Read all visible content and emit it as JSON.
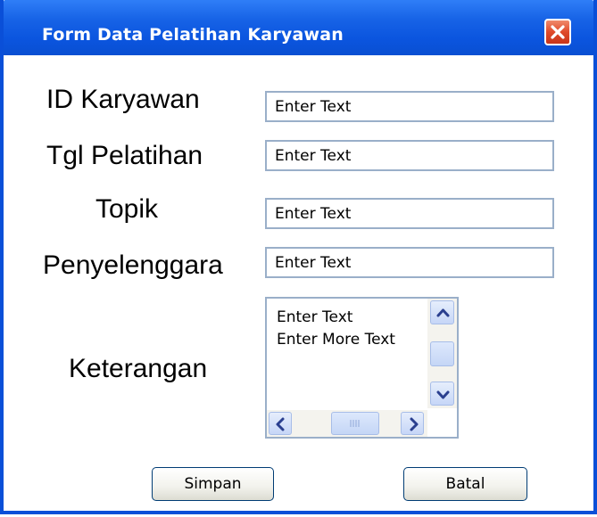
{
  "window": {
    "title": "Form Data Pelatihan Karyawan"
  },
  "fields": [
    {
      "label": "ID Karyawan",
      "value": "Enter Text"
    },
    {
      "label": "Tgl Pelatihan",
      "value": "Enter Text"
    },
    {
      "label": "Topik",
      "value": "Enter Text"
    },
    {
      "label": "Penyelenggara",
      "value": "Enter Text"
    }
  ],
  "keterangan": {
    "label": "Keterangan",
    "lines": [
      "Enter Text",
      "Enter More Text"
    ]
  },
  "buttons": {
    "save": "Simpan",
    "cancel": "Batal"
  },
  "icons": {
    "close": "close-icon",
    "scroll_up": "chevron-up-icon",
    "scroll_down": "chevron-down-icon",
    "scroll_left": "chevron-left-icon",
    "scroll_right": "chevron-right-icon",
    "thumb_grip": "grip-icon"
  },
  "colors": {
    "titlebar": "#0a4fd8",
    "close_button": "#df4a2a",
    "field_border": "#9aafc9"
  }
}
